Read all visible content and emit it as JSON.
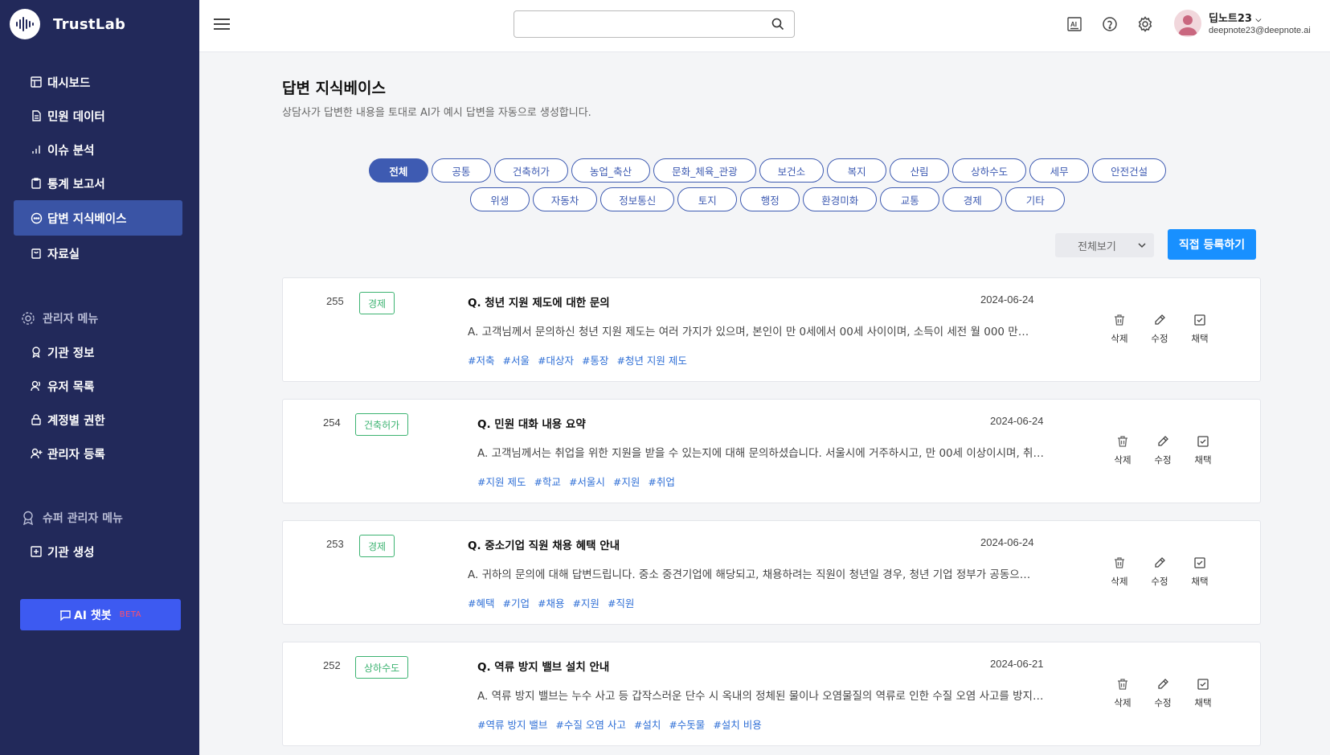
{
  "brand": {
    "name": "TrustLab",
    "logo_icon": "soundwave-logo-icon"
  },
  "sidebar": {
    "items": [
      {
        "label": "대시보드",
        "icon": "layout-icon"
      },
      {
        "label": "민원 데이터",
        "icon": "document-icon"
      },
      {
        "label": "이슈 분석",
        "icon": "bar-chart-icon"
      },
      {
        "label": "통계 보고서",
        "icon": "clipboard-icon"
      },
      {
        "label": "답변 지식베이스",
        "icon": "chat-icon",
        "active": true
      },
      {
        "label": "자료실",
        "icon": "archive-icon"
      }
    ],
    "admin_title": "관리자 메뉴",
    "admin_items": [
      {
        "label": "기관 정보",
        "icon": "award-icon"
      },
      {
        "label": "유저 목록",
        "icon": "users-icon"
      },
      {
        "label": "계정별 권한",
        "icon": "lock-icon"
      },
      {
        "label": "관리자 등록",
        "icon": "user-plus-icon"
      }
    ],
    "super_title": "슈퍼 관리자 메뉴",
    "super_items": [
      {
        "label": "기관 생성",
        "icon": "plus-square-icon"
      }
    ],
    "ai_button": {
      "label": "AI 챗봇",
      "badge": "BETA"
    }
  },
  "topbar": {
    "search": {
      "value": "",
      "placeholder": ""
    },
    "user": {
      "name": "딥노트23",
      "email": "deepnote23@deepnote.ai"
    }
  },
  "page": {
    "title": "답변 지식베이스",
    "subtitle": "상담사가 답변한 내용을 토대로 AI가 예시 답변을 자동으로 생성합니다."
  },
  "categories": [
    "전체",
    "공통",
    "건축허가",
    "농업_축산",
    "문화_체육_관광",
    "보건소",
    "복지",
    "산림",
    "상하수도",
    "세무",
    "안전건설",
    "위생",
    "자동차",
    "정보통신",
    "토지",
    "행정",
    "환경미화",
    "교통",
    "경제",
    "기타"
  ],
  "active_category": "전체",
  "filter": {
    "selected": "전체보기"
  },
  "register_button": "직접 등록하기",
  "actions": {
    "delete": "삭제",
    "edit": "수정",
    "adopt": "채택"
  },
  "entries": [
    {
      "id": "255",
      "category": "경제",
      "question": "Q. 청년 지원 제도에 대한 문의",
      "date": "2024-06-24",
      "answer": "A. 고객님께서 문의하신 청년 지원 제도는 여러 가지가 있으며, 본인이 만 0세에서 00세 사이이며, 소득이 세전 월 000 만원 이하일 경우 신청 가능합니다.",
      "tags": [
        "#저축",
        "#서울",
        "#대상자",
        "#통장",
        "#청년 지원 제도"
      ]
    },
    {
      "id": "254",
      "category": "건축허가",
      "question": "Q. 민원 대화 내용 요약",
      "date": "2024-06-24",
      "answer": "A. 고객님께서는 취업을 위한 지원을 받을 수 있는지에 대해 문의하셨습니다. 서울시에 거주하시고, 만 00세 이상이시며, 취업 준비 중이십니다.",
      "tags": [
        "#지원 제도",
        "#학교",
        "#서울시",
        "#지원",
        "#취업"
      ]
    },
    {
      "id": "253",
      "category": "경제",
      "question": "Q. 중소기업 직원 채용 혜택 안내",
      "date": "2024-06-24",
      "answer": "A. 귀하의 문의에 대해 답변드립니다. 중소 중견기업에 해당되고, 채용하려는 직원이 청년일 경우, 청년 기업 정부가 공동으로 지원하는 제도가 있습니다.",
      "tags": [
        "#혜택",
        "#기업",
        "#채용",
        "#지원",
        "#직원"
      ]
    },
    {
      "id": "252",
      "category": "상하수도",
      "question": "Q. 역류 방지 밸브 설치 안내",
      "date": "2024-06-21",
      "answer": "A. 역류 방지 밸브는 누수 사고 등 갑작스러운 단수 시 옥내의 정체된 물이나 오염물질의 역류로 인한 수질 오염 사고를 방지하기 위한 장치입니다.",
      "tags": [
        "#역류 방지 밸브",
        "#수질 오염 사고",
        "#설치",
        "#수돗물",
        "#설치 비용"
      ]
    }
  ],
  "colors": {
    "sidebar": "#22295a",
    "active_nav": "#3a54a5",
    "primary": "#3e5bb2",
    "register": "#1890ff",
    "tag": "#2f6fd6",
    "category_badge": "#3cb371",
    "ai_button": "#3d5af1"
  }
}
